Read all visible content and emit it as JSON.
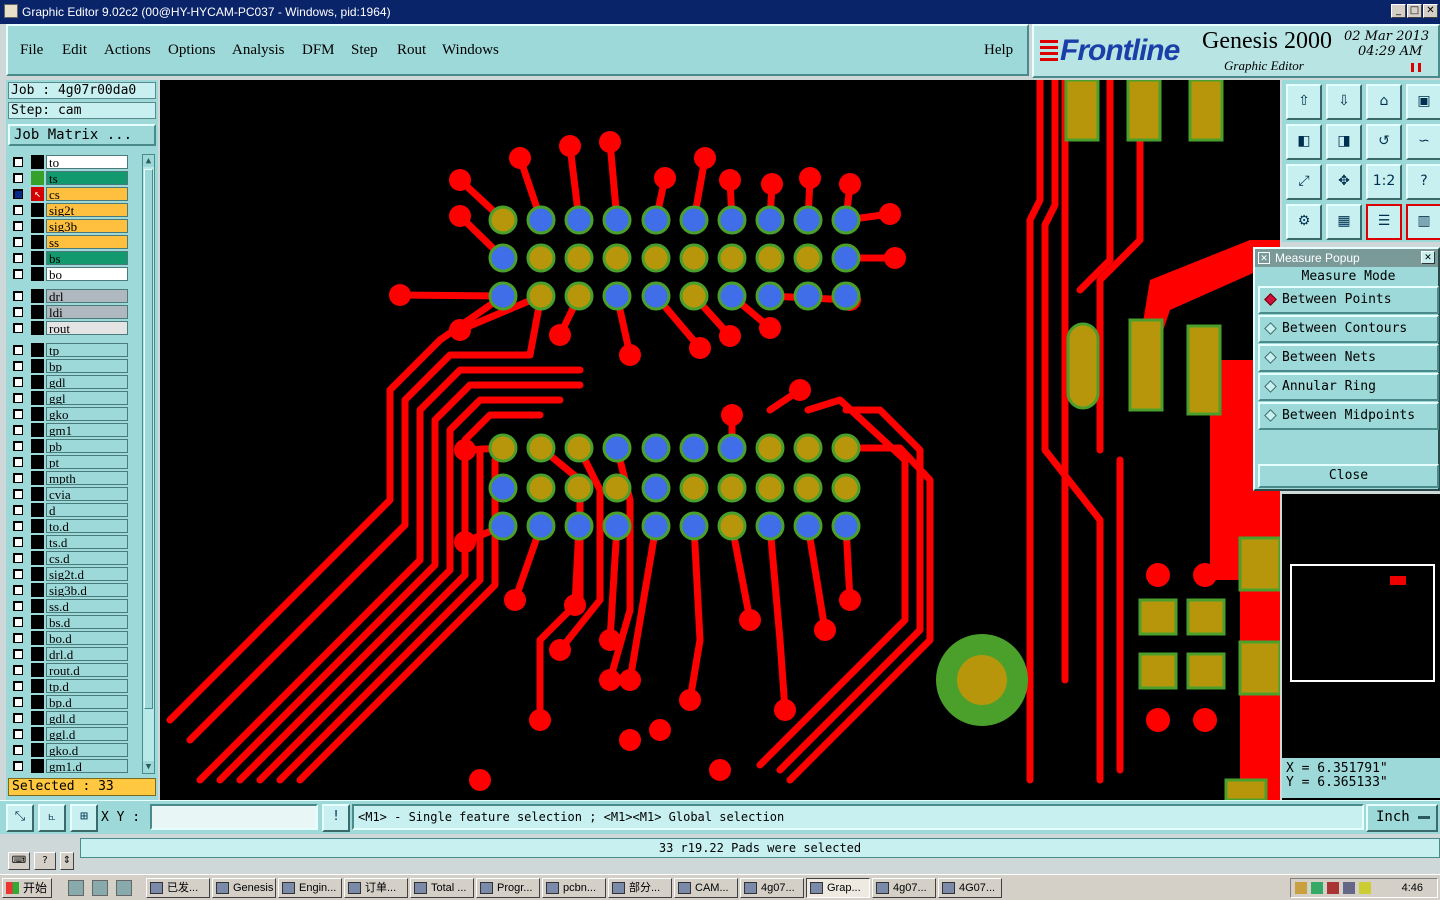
{
  "window": {
    "title": "Graphic Editor 9.02c2 (00@HY-HYCAM-PC037 - Windows, pid:1964)",
    "min": "_",
    "max": "□",
    "close": "✕"
  },
  "menu": [
    "File",
    "Edit",
    "Actions",
    "Options",
    "Analysis",
    "DFM",
    "Step",
    "Rout",
    "Windows"
  ],
  "help": "Help",
  "brand": {
    "logo": "Frontline",
    "product": "Genesis 2000",
    "subtitle": "Graphic Editor",
    "date_line1": "02 Mar 2013",
    "date_line2": "04:29 AM"
  },
  "job": {
    "job_line": "Job : 4g07r00da0",
    "step_line": "Step: cam",
    "matrix_button": "Job Matrix ..."
  },
  "layers": [
    {
      "name": "to",
      "color": "#ffffff",
      "swatch": "#000000",
      "checked": false,
      "selected": false
    },
    {
      "name": "ts",
      "color": "#129a6e",
      "swatch": "#35a02a",
      "checked": false,
      "selected": false
    },
    {
      "name": "cs",
      "color": "#ffc040",
      "swatch": "#d40000",
      "checked": true,
      "selected": true
    },
    {
      "name": "sig2t",
      "color": "#ffc040",
      "swatch": "#000000",
      "checked": false,
      "selected": false
    },
    {
      "name": "sig3b",
      "color": "#ffc040",
      "swatch": "#000000",
      "checked": false,
      "selected": false
    },
    {
      "name": "ss",
      "color": "#ffc040",
      "swatch": "#000000",
      "checked": false,
      "selected": false
    },
    {
      "name": "bs",
      "color": "#129a6e",
      "swatch": "#000000",
      "checked": false,
      "selected": false
    },
    {
      "name": "bo",
      "color": "#ffffff",
      "swatch": "#000000",
      "checked": false,
      "selected": false
    },
    {
      "name": "drl",
      "color": "#aeb8be",
      "swatch": "#000000",
      "checked": false,
      "selected": false
    },
    {
      "name": "ldi",
      "color": "#aeb8be",
      "swatch": "#000000",
      "checked": false,
      "selected": false
    },
    {
      "name": "rout",
      "color": "#e4e4e4",
      "swatch": "#000000",
      "checked": false,
      "selected": false
    },
    {
      "name": "tp",
      "color": "#9ed9d9",
      "swatch": "#000000",
      "checked": false,
      "selected": false
    },
    {
      "name": "bp",
      "color": "#9ed9d9",
      "swatch": "#000000",
      "checked": false,
      "selected": false
    },
    {
      "name": "gdl",
      "color": "#9ed9d9",
      "swatch": "#000000",
      "checked": false,
      "selected": false
    },
    {
      "name": "ggl",
      "color": "#9ed9d9",
      "swatch": "#000000",
      "checked": false,
      "selected": false
    },
    {
      "name": "gko",
      "color": "#9ed9d9",
      "swatch": "#000000",
      "checked": false,
      "selected": false
    },
    {
      "name": "gm1",
      "color": "#9ed9d9",
      "swatch": "#000000",
      "checked": false,
      "selected": false
    },
    {
      "name": "pb",
      "color": "#9ed9d9",
      "swatch": "#000000",
      "checked": false,
      "selected": false
    },
    {
      "name": "pt",
      "color": "#9ed9d9",
      "swatch": "#000000",
      "checked": false,
      "selected": false
    },
    {
      "name": "mpth",
      "color": "#9ed9d9",
      "swatch": "#000000",
      "checked": false,
      "selected": false
    },
    {
      "name": "cvia",
      "color": "#9ed9d9",
      "swatch": "#000000",
      "checked": false,
      "selected": false
    },
    {
      "name": "d",
      "color": "#9ed9d9",
      "swatch": "#000000",
      "checked": false,
      "selected": false
    },
    {
      "name": "to.d",
      "color": "#9ed9d9",
      "swatch": "#000000",
      "checked": false,
      "selected": false
    },
    {
      "name": "ts.d",
      "color": "#9ed9d9",
      "swatch": "#000000",
      "checked": false,
      "selected": false
    },
    {
      "name": "cs.d",
      "color": "#9ed9d9",
      "swatch": "#000000",
      "checked": false,
      "selected": false
    },
    {
      "name": "sig2t.d",
      "color": "#9ed9d9",
      "swatch": "#000000",
      "checked": false,
      "selected": false
    },
    {
      "name": "sig3b.d",
      "color": "#9ed9d9",
      "swatch": "#000000",
      "checked": false,
      "selected": false
    },
    {
      "name": "ss.d",
      "color": "#9ed9d9",
      "swatch": "#000000",
      "checked": false,
      "selected": false
    },
    {
      "name": "bs.d",
      "color": "#9ed9d9",
      "swatch": "#000000",
      "checked": false,
      "selected": false
    },
    {
      "name": "bo.d",
      "color": "#9ed9d9",
      "swatch": "#000000",
      "checked": false,
      "selected": false
    },
    {
      "name": "drl.d",
      "color": "#9ed9d9",
      "swatch": "#000000",
      "checked": false,
      "selected": false
    },
    {
      "name": "rout.d",
      "color": "#9ed9d9",
      "swatch": "#000000",
      "checked": false,
      "selected": false
    },
    {
      "name": "tp.d",
      "color": "#9ed9d9",
      "swatch": "#000000",
      "checked": false,
      "selected": false
    },
    {
      "name": "bp.d",
      "color": "#9ed9d9",
      "swatch": "#000000",
      "checked": false,
      "selected": false
    },
    {
      "name": "gdl.d",
      "color": "#9ed9d9",
      "swatch": "#000000",
      "checked": false,
      "selected": false
    },
    {
      "name": "ggl.d",
      "color": "#9ed9d9",
      "swatch": "#000000",
      "checked": false,
      "selected": false
    },
    {
      "name": "gko.d",
      "color": "#9ed9d9",
      "swatch": "#000000",
      "checked": false,
      "selected": false
    },
    {
      "name": "gm1.d",
      "color": "#9ed9d9",
      "swatch": "#000000",
      "checked": false,
      "selected": false
    }
  ],
  "selected_count": "Selected : 33",
  "tools": [
    "home-up-icon",
    "home-down-icon",
    "home-icon",
    "window-icon",
    "pan-left-icon",
    "pan-right-icon",
    "undo-zoom-icon",
    "redraw-icon",
    "zoom-fit-icon",
    "zoom-center-icon",
    "one-to-one-label",
    "help-question-icon",
    "settings-icon",
    "grid-icon",
    "layer-stack-icon",
    "layer-color-icon"
  ],
  "tool_one_to_one": "1:2",
  "measure_popup": {
    "title": "Measure Popup",
    "mode_label": "Measure Mode",
    "options": [
      "Between Points",
      "Between Contours",
      "Between Nets",
      "Annular Ring",
      "Between Midpoints"
    ],
    "selected_index": 0,
    "close_label": "Close"
  },
  "coords": {
    "x": "X = 6.351791\"",
    "y": "Y = 6.365133\""
  },
  "bottom": {
    "xy_label": "X Y :",
    "xy_value": "",
    "message": "<M1> - Single feature selection ; <M1><M1> Global selection",
    "unit": "Inch"
  },
  "status": "33 r19.22 Pads were selected",
  "taskbar": {
    "start": "开始",
    "tasks": [
      "已发...",
      "Genesis",
      "Engin...",
      "订单...",
      "Total ...",
      "Progr...",
      "pcbn...",
      "部分...",
      "CAM...",
      "4g07...",
      "Grap...",
      "4g07...",
      "4G07..."
    ],
    "active_index": 10,
    "clock": "4:46"
  },
  "colors": {
    "trace": "#ff0000",
    "pad_gold": "#b8960c",
    "pad_blue": "#3f6ee8",
    "pad_ring": "#4aa02a",
    "background": "#000000"
  }
}
